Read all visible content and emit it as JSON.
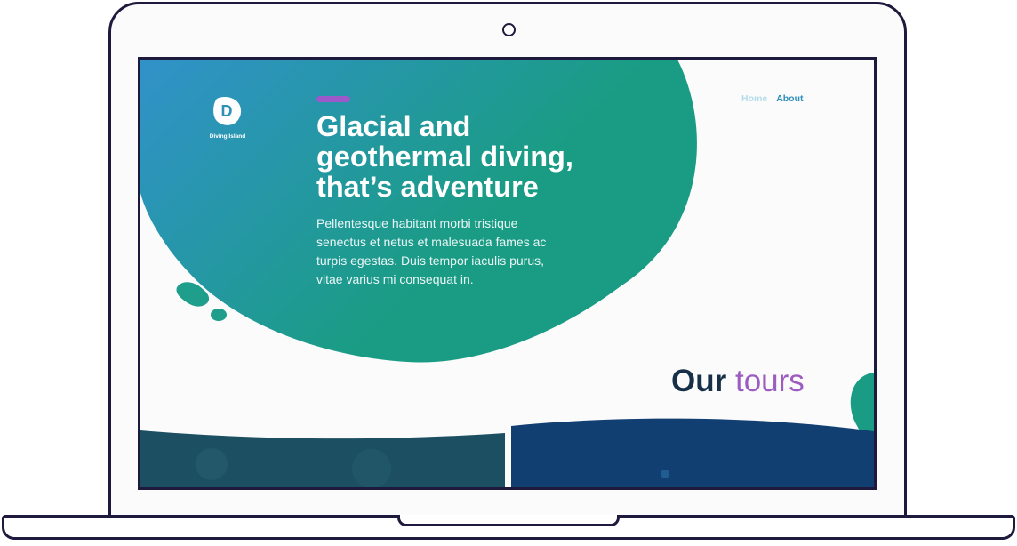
{
  "logo": {
    "letter": "D",
    "name": "Diving Island"
  },
  "nav": {
    "home": "Home",
    "about": "About"
  },
  "hero": {
    "title_lines": [
      "Glacial and",
      "geothermal diving,",
      "that’s adventure"
    ],
    "description": "Pellentesque habitant morbi tristique senectus et netus et malesuada fames ac turpis egestas. Duis tempor iaculis purus, vitae varius mi consequat in."
  },
  "tours": {
    "heading_strong": "Our",
    "heading_light": "tours"
  },
  "colors": {
    "gradient_start": "#3192c9",
    "gradient_end": "#1a9c84",
    "accent": "#9b59c9",
    "heading_dark": "#173047",
    "nav_active": "#2e8fb8",
    "laptop_outline": "#1d1a3e"
  }
}
